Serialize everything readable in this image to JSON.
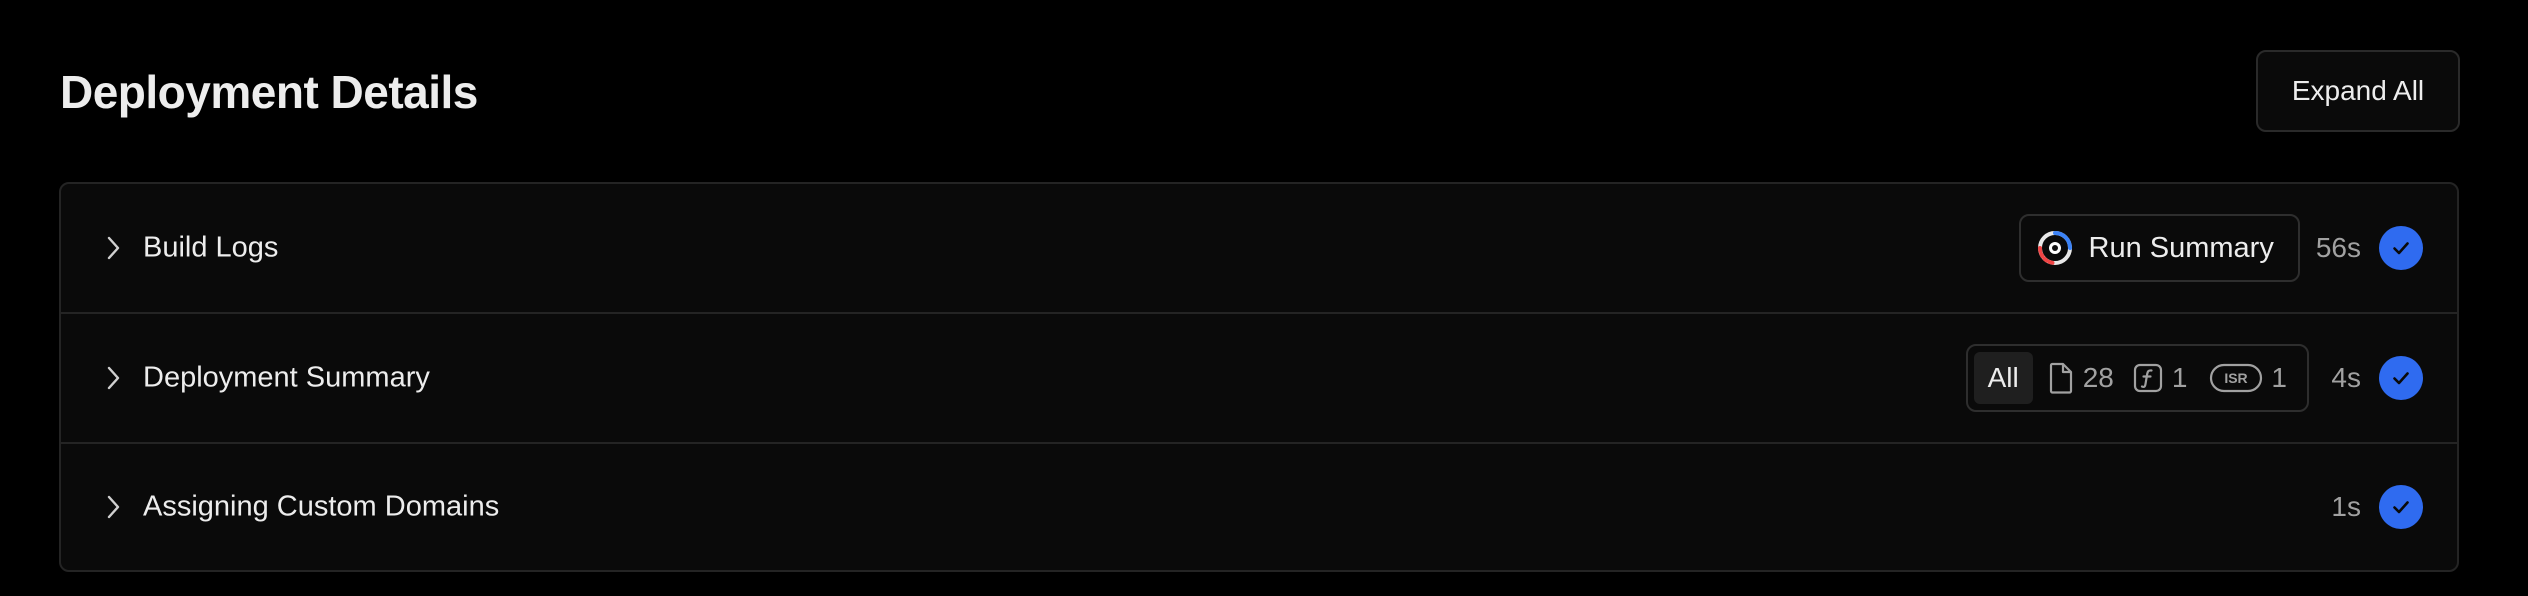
{
  "header": {
    "title": "Deployment Details",
    "expand_label": "Expand All"
  },
  "rows": [
    {
      "label": "Build Logs",
      "chip": {
        "label": "Run Summary",
        "icon": "run-summary-logo-icon"
      },
      "duration": "56s",
      "status": "success"
    },
    {
      "label": "Deployment Summary",
      "filters": {
        "all": "All",
        "static_count": "28",
        "function_count": "1",
        "isr_badge": "ISR",
        "isr_count": "1"
      },
      "duration": "4s",
      "status": "success"
    },
    {
      "label": "Assigning Custom Domains",
      "duration": "1s",
      "status": "success"
    }
  ],
  "colors": {
    "background": "#000000",
    "panel": "#0a0a0a",
    "border": "#242424",
    "success": "#2f6bf0",
    "muted_text": "#a1a1a1"
  }
}
